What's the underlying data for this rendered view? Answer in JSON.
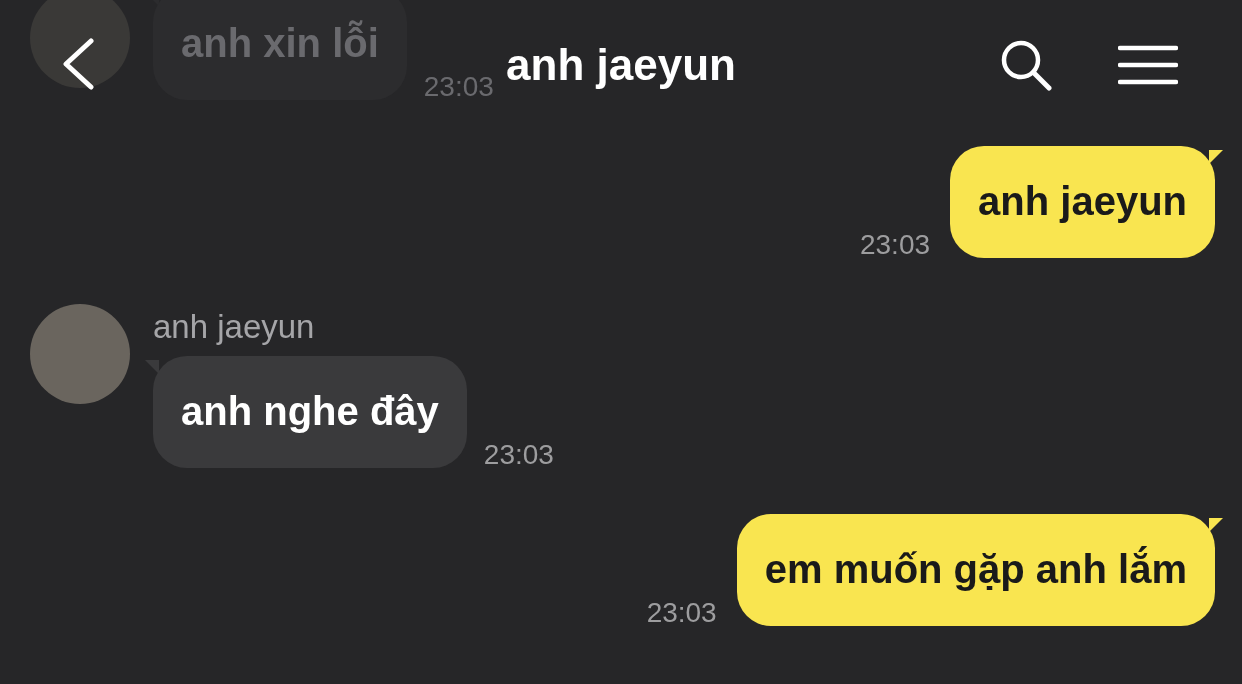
{
  "header": {
    "title": "anh jaeyun"
  },
  "messages": [
    {
      "kind": "incoming",
      "faded": true,
      "text": "anh xin lỗi",
      "time": "23:03"
    },
    {
      "kind": "outgoing",
      "text": "anh jaeyun",
      "time": "23:03"
    },
    {
      "kind": "incoming",
      "sender": "anh jaeyun",
      "text": "anh nghe đây",
      "time": "23:03"
    },
    {
      "kind": "outgoing",
      "text": "em muốn gặp anh lắm",
      "time": "23:03"
    }
  ]
}
